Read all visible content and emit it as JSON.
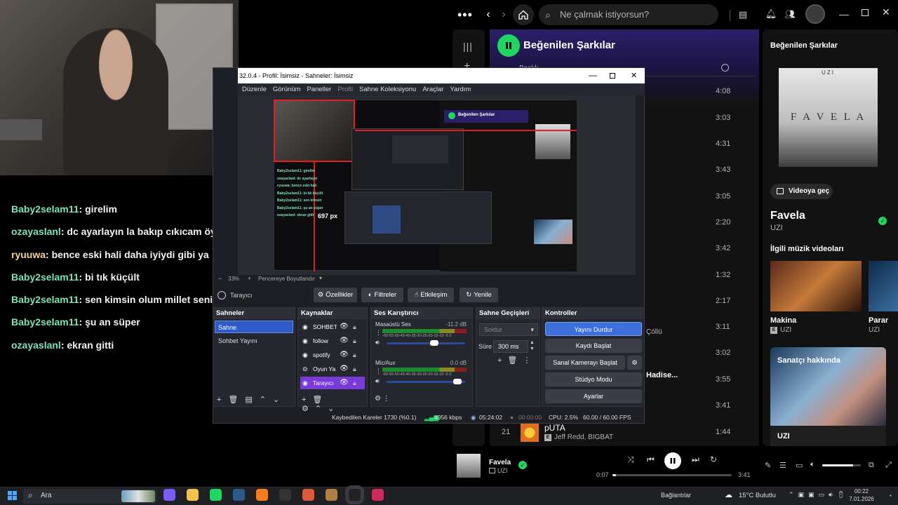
{
  "webcam": {},
  "chat": [
    {
      "user": "Baby2selam11",
      "msg": "girelim",
      "alt": false
    },
    {
      "user": "ozayaslanl",
      "msg": "dc ayarlayın la bakıp cıkıcam öyle",
      "alt": false
    },
    {
      "user": "ryuuwa",
      "msg": "bence eski hali daha iyiydi gibi ya",
      "alt": true
    },
    {
      "user": "Baby2selam11",
      "msg": "bi tık küçült",
      "alt": false
    },
    {
      "user": "Baby2selam11",
      "msg": "sen kimsin olum millet seni izliycek lelipop",
      "alt": false
    },
    {
      "user": "Baby2selam11",
      "msg": "şu an süper",
      "alt": false
    },
    {
      "user": "ozayaslanl",
      "msg": "ekran gitti",
      "alt": false
    }
  ],
  "spotify": {
    "search_placeholder": "Ne çalmak istiyorsun?",
    "playlist_title": "Beğenilen Şarkılar",
    "column_title": "Başlık",
    "durations": [
      "4:08",
      "3:03",
      "4:31",
      "3:43",
      "3:05",
      "2:20",
      "3:42",
      "1:32",
      "2:17",
      "3:11",
      "3:02",
      "3:55",
      "3:41",
      "1:44"
    ],
    "visible_track_fragments": {
      "chollu": "Çöllü",
      "hadise": "Hadise..."
    },
    "last_track": {
      "num": "21",
      "title": "pUTA",
      "artists": "Jeff Redd, BIGBAT",
      "badge": "E"
    },
    "right_panel": {
      "header": "Beğenilen Şarkılar",
      "cover_artist": "UZI",
      "cover_word": "F A V E L A",
      "video_button": "Videoya geç",
      "song_title": "Favela",
      "song_artist": "UZI",
      "related_title": "İlgili müzik videoları",
      "videos": [
        {
          "title": "Makina",
          "artist": "UZI"
        },
        {
          "title": "Parar",
          "artist": "UZI"
        }
      ],
      "about_title": "Sanatçı hakkında",
      "about_name": "UZI"
    },
    "now_playing": {
      "title": "Favela",
      "artist": "UZI",
      "elapsed": "0:07",
      "total": "3:41",
      "progress": 0.03,
      "volume": 0.8
    }
  },
  "obs": {
    "title": "32.0.4 - Profil: İsimsiz - Sahneler: İsimsiz",
    "menu": [
      "Düzenle",
      "Görünüm",
      "Paneller",
      "Profil",
      "Sahne Koleksiyonu",
      "Araçlar",
      "Yardım"
    ],
    "zoom": "33%",
    "fit_label": "Pencereye Boyutlandır",
    "preview_label": "697 px",
    "source_label": "Tarayıcı",
    "filter_buttons": [
      "Özellikler",
      "Filtreler",
      "Etkileşim",
      "Yenile"
    ],
    "panels": {
      "scenes": {
        "title": "Sahneler",
        "items": [
          "Sahne",
          "Sohbet Yayını"
        ]
      },
      "sources": {
        "title": "Kaynaklar",
        "items": [
          "SOHBET",
          "follow",
          "spotify",
          "Oyun Ya",
          "Tarayıcı"
        ]
      },
      "mixer": {
        "title": "Ses Karıştırıcı",
        "channels": [
          {
            "name": "Masaüstü Ses",
            "db": "-11.2 dB",
            "volume": 0.55
          },
          {
            "name": "Mic/Aux",
            "db": "0.0 dB",
            "volume": 0.85
          }
        ],
        "scale": "-60-55-50-45-40-35-30-25-20-15-10 -5 0"
      },
      "transitions": {
        "title": "Sahne Geçişleri",
        "type": "Soldur",
        "duration_label": "Süre",
        "duration": "300 ms"
      },
      "controls": {
        "title": "Kontroller",
        "buttons": [
          "Yayını Durdur",
          "Kaydı Başlat",
          "Sanal Kamerayı Başlat",
          "Stüdyo Modu",
          "Ayarlar"
        ]
      }
    },
    "status": {
      "dropped": "Kaybedilen Kareler 1730 (%0.1)",
      "bitrate": "4956 kbps",
      "stream_time": "05:24:02",
      "rec_time": "00:00:00",
      "cpu": "CPU: 2.5%",
      "fps": "60.00 / 60.00 FPS"
    }
  },
  "taskbar": {
    "search": "Ara",
    "network_label": "Bağlantılar",
    "weather": "15°C Bulutlu",
    "time": "00:22",
    "date": "7.01.2026"
  },
  "colors": {
    "spotify_green": "#1ed760",
    "obs_blue": "#3a6fdc",
    "chat_name": "#7fe3b9"
  }
}
